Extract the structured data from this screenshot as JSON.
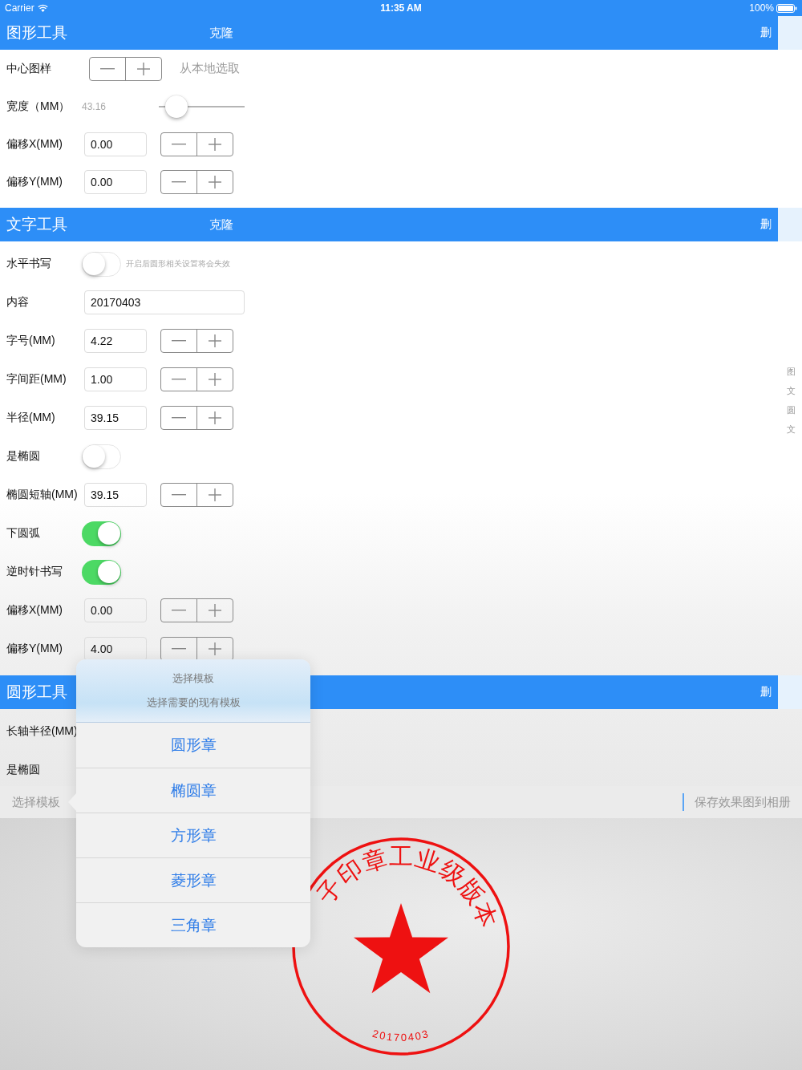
{
  "status_bar": {
    "carrier": "Carrier",
    "time": "11:35 AM",
    "battery": "100%"
  },
  "sections": [
    {
      "title": "图形工具",
      "clone": "克隆",
      "delete": "删",
      "rows": [
        {
          "kind": "pattern",
          "label": "中心图样",
          "action": "从本地选取"
        },
        {
          "kind": "slider",
          "label": "宽度（MM）",
          "reading": "43.16",
          "level": 0.1
        },
        {
          "kind": "number",
          "label": "偏移X(MM)",
          "value": "0.00"
        },
        {
          "kind": "number",
          "label": "偏移Y(MM)",
          "value": "0.00"
        }
      ]
    },
    {
      "title": "文字工具",
      "clone": "克隆",
      "delete": "删",
      "rows": [
        {
          "kind": "switch",
          "label": "水平书写",
          "on": false,
          "hint": "开启后圆形相关设置将会失效"
        },
        {
          "kind": "text",
          "label": "内容",
          "value": "20170403"
        },
        {
          "kind": "number",
          "label": "字号(MM)",
          "value": "4.22"
        },
        {
          "kind": "number",
          "label": "字间距(MM)",
          "value": "1.00"
        },
        {
          "kind": "number",
          "label": "半径(MM)",
          "value": "39.15"
        },
        {
          "kind": "switch",
          "label": "是椭圆",
          "on": false
        },
        {
          "kind": "number",
          "label": "椭圆短轴(MM)",
          "value": "39.15"
        },
        {
          "kind": "switch",
          "label": "下圆弧",
          "on": true
        },
        {
          "kind": "switch",
          "label": "逆时针书写",
          "on": true
        },
        {
          "kind": "number",
          "label": "偏移X(MM)",
          "value": "0.00"
        },
        {
          "kind": "number",
          "label": "偏移Y(MM)",
          "value": "4.00"
        }
      ]
    },
    {
      "title": "圆形工具",
      "delete": "删",
      "rows": [
        {
          "kind": "label",
          "label": "长轴半径(MM)"
        },
        {
          "kind": "label",
          "label": "是椭圆"
        }
      ]
    }
  ],
  "section_index": [
    "图",
    "文",
    "圆",
    "文"
  ],
  "toolbar": {
    "template_button": "选择模板",
    "save_button": "保存效果图到相册"
  },
  "popover": {
    "title": "选择模板",
    "message": "选择需要的现有模板",
    "options": [
      "圆形章",
      "椭圆章",
      "方形章",
      "菱形章",
      "三角章"
    ]
  },
  "stamp": {
    "arc_text": "子印章工业级版本",
    "date": "20170403"
  }
}
